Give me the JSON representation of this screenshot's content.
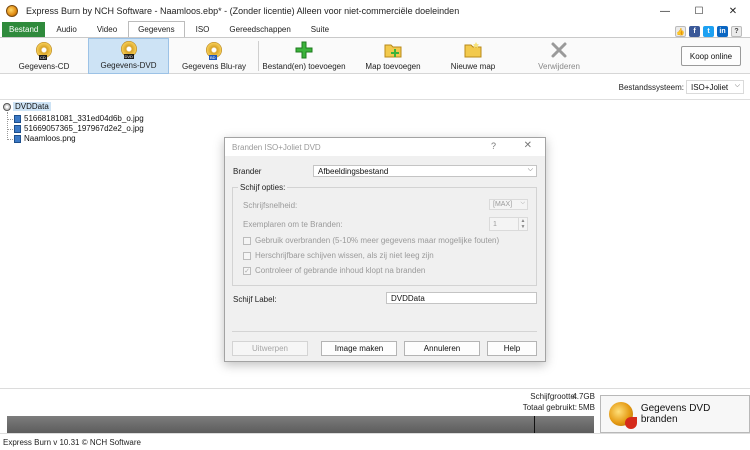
{
  "window": {
    "title": "Express Burn by NCH Software - Naamloos.ebp* - (Zonder licentie) Alleen voor niet-commerciële doeleinden",
    "minimize": "—",
    "maximize": "☐",
    "close": "✕"
  },
  "menu": {
    "items": [
      "Bestand",
      "Audio",
      "Video",
      "Gegevens",
      "ISO",
      "Gereedschappen",
      "Suite"
    ],
    "active": "Gegevens",
    "social": [
      "like-icon",
      "facebook-icon",
      "twitter-icon",
      "linkedin-icon",
      "help-icon"
    ]
  },
  "toolbar": {
    "buttons": [
      {
        "label": "Gegevens-CD",
        "icon": "cd-disc-icon",
        "badge": "CD"
      },
      {
        "label": "Gegevens-DVD",
        "icon": "dvd-disc-icon",
        "badge": "DVD",
        "selected": true
      },
      {
        "label": "Gegevens Blu-ray",
        "icon": "bluray-disc-icon",
        "badge": "BD"
      },
      {
        "label": "Bestand(en) toevoegen",
        "icon": "add-plus-icon"
      },
      {
        "label": "Map toevoegen",
        "icon": "add-folder-icon"
      },
      {
        "label": "Nieuwe map",
        "icon": "new-folder-icon"
      },
      {
        "label": "Verwijderen",
        "icon": "remove-x-icon",
        "disabled": true
      }
    ],
    "buy_label": "Koop online"
  },
  "filesystem": {
    "label": "Bestandssysteem:",
    "value": "ISO+Joliet"
  },
  "tree": {
    "root": "DVDData",
    "files": [
      "51668181081_331ed04d6b_o.jpg",
      "51669057365_197967d2e2_o.jpg",
      "Naamloos.png"
    ]
  },
  "dialog": {
    "title": "Branden ISO+Joliet DVD",
    "help_glyph": "?",
    "close_glyph": "✕",
    "brander_label": "Brander",
    "brander_value": "Afbeeldingsbestand",
    "options_title": "Schijf opties:",
    "speed_label": "Schrijfsnelheid:",
    "speed_value": "[MAX]",
    "copies_label": "Exemplaren om te Branden:",
    "copies_value": "1",
    "checkboxes": [
      {
        "label": "Gebruik overbranden (5-10% meer gegevens maar mogelijke fouten)",
        "checked": false
      },
      {
        "label": "Herschrijfbare schijven wissen, als zij niet leeg zijn",
        "checked": false
      },
      {
        "label": "Controleer of gebrande inhoud klopt na branden",
        "checked": true
      }
    ],
    "disc_label_label": "Schijf Label:",
    "disc_label_value": "DVDData",
    "buttons": {
      "eject": "Uitwerpen",
      "image": "Image maken",
      "cancel": "Annuleren",
      "help": "Help"
    }
  },
  "stats": {
    "size_label": "Schijfgrootte:",
    "size_value": "4.7GB",
    "used_label": "Totaal gebruikt:",
    "used_value": "5MB"
  },
  "burn_button": "Gegevens DVD branden",
  "statusbar": "Express Burn v 10.31 © NCH Software"
}
